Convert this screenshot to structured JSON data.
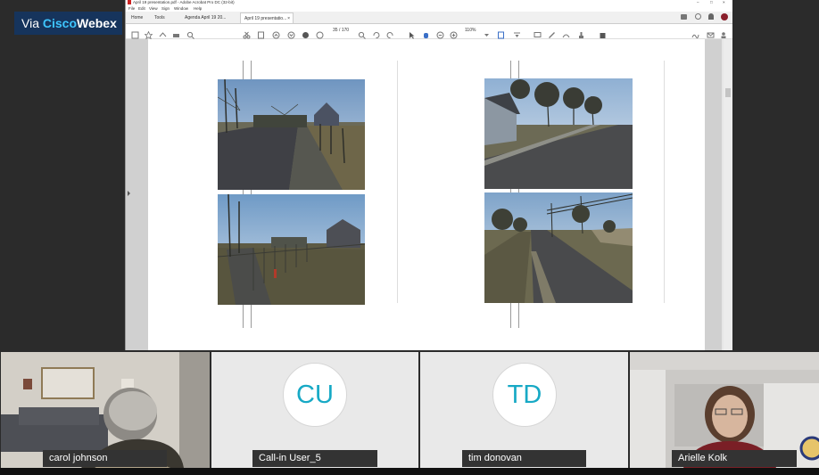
{
  "badge": {
    "via": "Via ",
    "brand1": "Cisco",
    "brand2": "Webex"
  },
  "app": {
    "title": "April 19 presentation.pdf - Adobe Acrobat Pro DC (32-bit)",
    "menu": [
      "File",
      "Edit",
      "View",
      "Sign",
      "Window",
      "Help"
    ],
    "tabs": [
      {
        "label": "Home"
      },
      {
        "label": "Tools"
      },
      {
        "label": "Agenda April 19 20..."
      },
      {
        "label": "April 19 presentatio..."
      }
    ],
    "page_indicator": "35 / 170",
    "zoom": "110%"
  },
  "document": {
    "photos": [
      {
        "name": "street-view-1",
        "desc": "street with trees"
      },
      {
        "name": "street-view-2",
        "desc": "street with garage"
      },
      {
        "name": "street-view-3",
        "desc": "lawn and fence"
      },
      {
        "name": "street-view-4",
        "desc": "road with power lines"
      }
    ]
  },
  "participants": [
    {
      "name": "carol johnson",
      "type": "video"
    },
    {
      "name": "Call-in User_5",
      "initials": "CU",
      "type": "avatar"
    },
    {
      "name": "tim donovan",
      "initials": "TD",
      "type": "avatar"
    },
    {
      "name": "Arielle Kolk",
      "type": "video"
    }
  ],
  "colors": {
    "accent": "#17a9c5",
    "brand_bg": "#16345c"
  }
}
